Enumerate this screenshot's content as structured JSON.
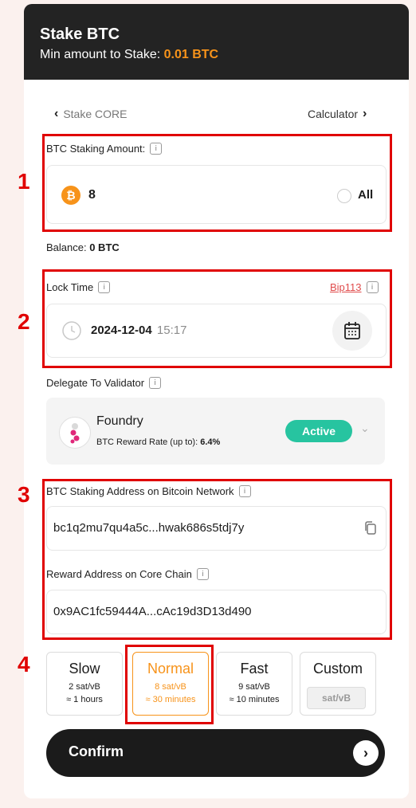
{
  "header": {
    "title": "Stake BTC",
    "min_label": "Min amount to Stake: ",
    "min_value": "0.01 BTC"
  },
  "nav": {
    "back_label": "Stake CORE",
    "calculator_label": "Calculator"
  },
  "amount": {
    "label": "BTC Staking Amount:",
    "value": "8",
    "all_label": "All",
    "balance_label": "Balance:",
    "balance_value": "0 BTC"
  },
  "lock_time": {
    "label": "Lock Time",
    "bip_link": "Bip113",
    "date": "2024-12-04",
    "time": "15:17"
  },
  "validator": {
    "label": "Delegate To Validator",
    "name": "Foundry",
    "reward_label": "BTC Reward Rate (up to):",
    "reward_value": "6.4%",
    "status": "Active"
  },
  "addresses": {
    "btc_label": "BTC Staking Address on Bitcoin Network",
    "btc_value": "bc1q2mu7qu4a5c...hwak686s5tdj7y",
    "reward_label": "Reward Address on Core Chain",
    "reward_value": "0x9AC1fc59444A...cAc19d3D13d490"
  },
  "fees": [
    {
      "name": "Slow",
      "rate": "2 sat/vB",
      "time": "≈ 1 hours"
    },
    {
      "name": "Normal",
      "rate": "8 sat/vB",
      "time": "≈ 30 minutes"
    },
    {
      "name": "Fast",
      "rate": "9 sat/vB",
      "time": "≈ 10 minutes"
    },
    {
      "name": "Custom",
      "placeholder": "sat/vB"
    }
  ],
  "confirm_label": "Confirm",
  "annotations": [
    "1",
    "2",
    "3",
    "4"
  ],
  "colors": {
    "accent": "#f7931a",
    "active": "#27c4a0",
    "annotation": "#e00000",
    "dark": "#232323"
  }
}
